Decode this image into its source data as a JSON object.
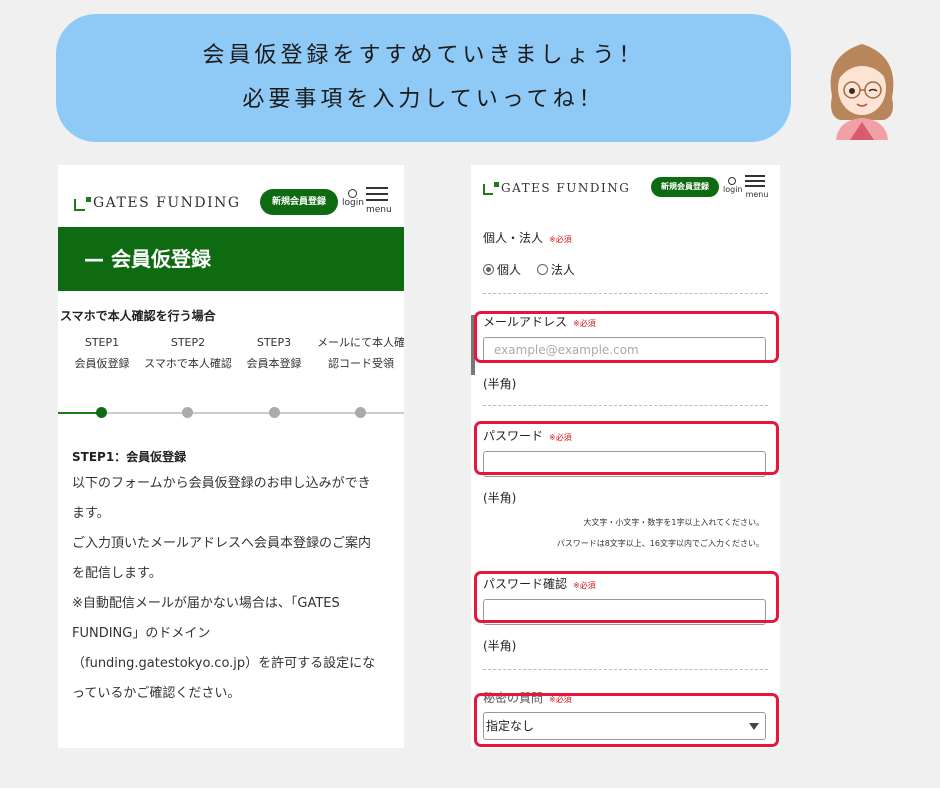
{
  "bubble": {
    "line1": "会員仮登録をすすめていきましょう！",
    "line2": "必要事項を入力していってね！"
  },
  "colors": {
    "brand_green": "#0f6b12",
    "bubble_blue": "#8fcaf7",
    "highlight_red": "#e5173f",
    "required_red": "#d01818"
  },
  "header": {
    "logo_text": "GATES FUNDING",
    "register_button": "新規会員登録",
    "login_label": "login",
    "menu_label": "menu",
    "login_icon": "person-icon",
    "menu_icon": "hamburger-icon"
  },
  "left": {
    "page_title": "— 会員仮登録",
    "steps_heading": "スマホで本人確認を行う場合",
    "steps": [
      {
        "num": "STEP1",
        "label": "会員仮登録"
      },
      {
        "num": "STEP2",
        "label": "スマホで本人確認"
      },
      {
        "num": "STEP3",
        "label": "会員本登録"
      },
      {
        "num": "メールにて本人確",
        "label": "認コード受領"
      }
    ],
    "current_step_index": 0,
    "body_heading": "STEP1：会員仮登録",
    "body_lines": [
      "以下のフォームから会員仮登録のお申し込みができ",
      "ます。",
      "ご入力頂いたメールアドレスへ会員本登録のご案内",
      "を配信します。",
      "※自動配信メールが届かない場合は、「GATES",
      "FUNDING」のドメイン",
      "（funding.gatestokyo.co.jp）を許可する設定にな",
      "っているかご確認ください。"
    ]
  },
  "right": {
    "type_label": "個人・法人",
    "required": "※必須",
    "radio_individual": "個人",
    "radio_corporate": "法人",
    "email_label": "メールアドレス",
    "email_placeholder": "example@example.com",
    "half_width": "(半角)",
    "password_label": "パスワード",
    "password_note1": "大文字・小文字・数字を1字以上入れてください。",
    "password_note2": "パスワードは8文字以上、16文字以内でご入力ください。",
    "password_confirm_label": "パスワード確認",
    "secret_question_label": "秘密の質問",
    "secret_question_value": "指定なし"
  }
}
